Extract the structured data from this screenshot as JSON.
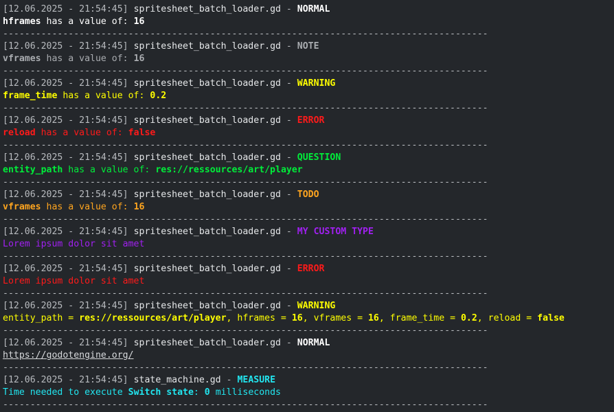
{
  "separator": "-----------------------------------------------------------------------------------------",
  "entries": [
    {
      "timestamp": "[12.06.2025 - 21:54:45]",
      "file": "spritesheet_batch_loader.gd",
      "dash": " - ",
      "type": "NORMAL",
      "type_color": "#ffffff",
      "msg_color": "#ffffff",
      "message": [
        {
          "t": "hframes",
          "b": true
        },
        {
          "t": " has a value of: "
        },
        {
          "t": "16",
          "b": true
        }
      ]
    },
    {
      "timestamp": "[12.06.2025 - 21:54:45]",
      "file": "spritesheet_batch_loader.gd",
      "dash": " - ",
      "type": "NOTE",
      "type_color": "#a9acb0",
      "msg_color": "#a9acb0",
      "message": [
        {
          "t": "vframes",
          "b": true
        },
        {
          "t": " has a value of: "
        },
        {
          "t": "16",
          "b": true
        }
      ]
    },
    {
      "timestamp": "[12.06.2025 - 21:54:45]",
      "file": "spritesheet_batch_loader.gd",
      "dash": " - ",
      "type": "WARNING",
      "type_color": "#ffff00",
      "msg_color": "#ffff00",
      "message": [
        {
          "t": "frame_time",
          "b": true
        },
        {
          "t": " has a value of: "
        },
        {
          "t": "0.2",
          "b": true
        }
      ]
    },
    {
      "timestamp": "[12.06.2025 - 21:54:45]",
      "file": "spritesheet_batch_loader.gd",
      "dash": " - ",
      "type": "ERROR",
      "type_color": "#ff1a1a",
      "msg_color": "#ff1a1a",
      "message": [
        {
          "t": "reload",
          "b": true
        },
        {
          "t": " has a value of: "
        },
        {
          "t": "false",
          "b": true
        }
      ]
    },
    {
      "timestamp": "[12.06.2025 - 21:54:45]",
      "file": "spritesheet_batch_loader.gd",
      "dash": " - ",
      "type": "QUESTION",
      "type_color": "#00ee3a",
      "msg_color": "#00ee3a",
      "message": [
        {
          "t": "entity_path",
          "b": true
        },
        {
          "t": " has a value of: "
        },
        {
          "t": "res://ressources/art/player",
          "b": true
        }
      ]
    },
    {
      "timestamp": "[12.06.2025 - 21:54:45]",
      "file": "spritesheet_batch_loader.gd",
      "dash": " - ",
      "type": "TODO",
      "type_color": "#ffa51f",
      "msg_color": "#ffa51f",
      "message": [
        {
          "t": "vframes",
          "b": true
        },
        {
          "t": " has a value of: "
        },
        {
          "t": "16",
          "b": true
        }
      ]
    },
    {
      "timestamp": "[12.06.2025 - 21:54:45]",
      "file": "spritesheet_batch_loader.gd",
      "dash": " - ",
      "type": "MY CUSTOM TYPE",
      "type_color": "#a020f0",
      "msg_color": "#a020f0",
      "message": [
        {
          "t": "Lorem ipsum dolor sit amet"
        }
      ]
    },
    {
      "timestamp": "[12.06.2025 - 21:54:45]",
      "file": "spritesheet_batch_loader.gd",
      "dash": " - ",
      "type": "ERROR",
      "type_color": "#ff1a1a",
      "msg_color": "#ff1a1a",
      "message": [
        {
          "t": "Lorem ipsum dolor sit amet"
        }
      ]
    },
    {
      "timestamp": "[12.06.2025 - 21:54:45]",
      "file": "spritesheet_batch_loader.gd",
      "dash": " - ",
      "type": "WARNING",
      "type_color": "#ffff00",
      "msg_color": "#ffff00",
      "message": [
        {
          "t": "entity_path = "
        },
        {
          "t": "res://ressources/art/player",
          "b": true
        },
        {
          "t": ", hframes = "
        },
        {
          "t": "16",
          "b": true
        },
        {
          "t": ", vframes = "
        },
        {
          "t": "16",
          "b": true
        },
        {
          "t": ", frame_time = "
        },
        {
          "t": "0.2",
          "b": true
        },
        {
          "t": ", reload = "
        },
        {
          "t": "false",
          "b": true
        }
      ]
    },
    {
      "timestamp": "[12.06.2025 - 21:54:45]",
      "file": "spritesheet_batch_loader.gd",
      "dash": " - ",
      "type": "NORMAL",
      "type_color": "#ffffff",
      "msg_color": "#e6e8ea",
      "message": [
        {
          "t": "https://godotengine.org/",
          "link": true
        }
      ]
    },
    {
      "timestamp": "[12.06.2025 - 21:54:45]",
      "file": "state_machine.gd",
      "dash": " - ",
      "type": "MEASURE",
      "type_color": "#22e6f0",
      "msg_color": "#22e6f0",
      "message": [
        {
          "t": "Time needed to execute "
        },
        {
          "t": "Switch state",
          "b": true
        },
        {
          "t": ": "
        },
        {
          "t": "0",
          "b": true
        },
        {
          "t": " milliseconds"
        }
      ]
    }
  ]
}
